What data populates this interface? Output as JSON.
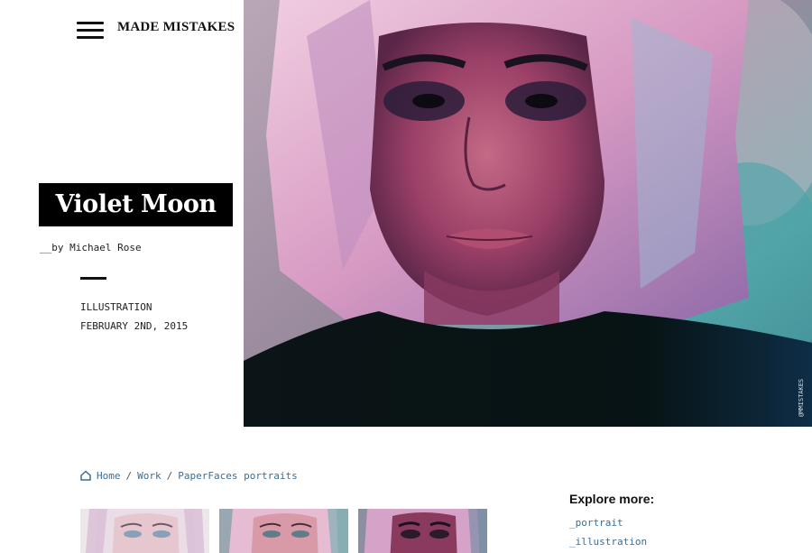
{
  "header": {
    "menu_icon": "hamburger-menu-icon",
    "site_title": "MADE MISTAKES"
  },
  "post": {
    "title": "Violet Moon",
    "byline_prefix": "__by ",
    "author": "Michael Rose",
    "category": "ILLUSTRATION",
    "date": "FEBRUARY 2ND, 2015"
  },
  "hero": {
    "signature": "@MMISTAKES",
    "palette": {
      "hair": "#e8b7d6",
      "face": "#a44a6e",
      "shirt": "#0a1a1a",
      "background": "#6fb3b3"
    }
  },
  "breadcrumb": {
    "home_icon": "home-icon",
    "items": [
      "Home",
      "Work",
      "PaperFaces portraits"
    ],
    "separator": "/"
  },
  "explore": {
    "title": "Explore more:",
    "links": [
      "_portrait",
      "_illustration"
    ]
  },
  "colors": {
    "link": "#3a6f9a",
    "text": "#111111",
    "title_bg": "#000000"
  }
}
